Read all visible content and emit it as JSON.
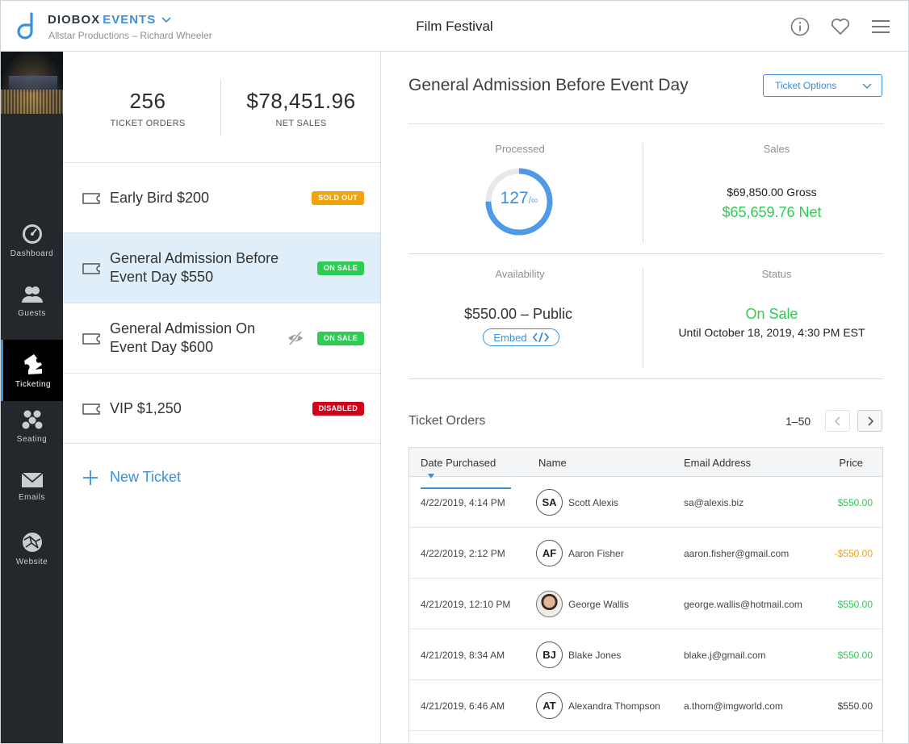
{
  "header": {
    "brand_name": "DIOBOX",
    "brand_product": "EVENTS",
    "organization": "Allstar Productions – Richard Wheeler",
    "event_title": "Film Festival"
  },
  "nav": {
    "items": [
      {
        "label": "Dashboard",
        "icon": "dashboard-icon"
      },
      {
        "label": "Guests",
        "icon": "guests-icon"
      },
      {
        "label": "Ticketing",
        "icon": "ticketing-icon",
        "active": true
      },
      {
        "label": "Seating",
        "icon": "seating-icon"
      },
      {
        "label": "Emails",
        "icon": "emails-icon"
      },
      {
        "label": "Website",
        "icon": "website-icon"
      }
    ]
  },
  "summary": {
    "orders_value": "256",
    "orders_label": "TICKET ORDERS",
    "sales_value": "$78,451.96",
    "sales_label": "NET SALES"
  },
  "tickets": [
    {
      "name_line1": "Early Bird $200",
      "name_line2": "",
      "badge": "SOLD OUT",
      "badge_color": "#f0a30a"
    },
    {
      "name_line1": "General Admission Before",
      "name_line2": "Event Day $550",
      "badge": "ON SALE",
      "badge_color": "#2ecc52",
      "selected": true
    },
    {
      "name_line1": "General Admission On",
      "name_line2": "Event Day $600",
      "badge": "ON SALE",
      "badge_color": "#2ecc52",
      "hidden": true
    },
    {
      "name_line1": "VIP $1,250",
      "name_line2": "",
      "badge": "DISABLED",
      "badge_color": "#d0021b"
    }
  ],
  "new_ticket_label": "New Ticket",
  "detail": {
    "title": "General Admission Before Event Day",
    "options_label": "Ticket Options",
    "processed_label": "Processed",
    "processed_count": "127",
    "processed_of": "/∞",
    "processed_fraction": 0.75,
    "sales_label": "Sales",
    "gross": "$69,850.00 Gross",
    "net": "$65,659.76 Net",
    "availability_label": "Availability",
    "availability_value": "$550.00 – Public",
    "embed_label": "Embed",
    "status_label": "Status",
    "status_value": "On Sale",
    "status_until": "Until October 18, 2019, 4:30 PM EST"
  },
  "orders": {
    "title": "Ticket Orders",
    "range": "1–50",
    "columns": [
      "Date Purchased",
      "Name",
      "Email Address",
      "Price"
    ],
    "rows": [
      {
        "date": "4/22/2019, 4:14 PM",
        "initials": "SA",
        "name": "Scott Alexis",
        "email": "sa@alexis.biz",
        "price": "$550.00",
        "kind": "pos"
      },
      {
        "date": "4/22/2019, 2:12 PM",
        "initials": "AF",
        "name": "Aaron Fisher",
        "email": "aaron.fisher@gmail.com",
        "price": "-$550.00",
        "kind": "neg"
      },
      {
        "date": "4/21/2019, 12:10 PM",
        "initials": "",
        "name": "George Wallis",
        "email": "george.wallis@hotmail.com",
        "price": "$550.00",
        "kind": "pos",
        "photo": true
      },
      {
        "date": "4/21/2019, 8:34 AM",
        "initials": "BJ",
        "name": "Blake Jones",
        "email": "blake.j@gmail.com",
        "price": "$550.00",
        "kind": "pos"
      },
      {
        "date": "4/21/2019, 6:46 AM",
        "initials": "AT",
        "name": "Alexandra Thompson",
        "email": "a.thom@imgworld.com",
        "price": "$550.00",
        "kind": "plain"
      }
    ]
  },
  "colors": {
    "accent": "#3b8fdc",
    "sidebar": "#24282c",
    "positive": "#2ecc52",
    "warning": "#f0a30a",
    "danger": "#d0021b"
  }
}
